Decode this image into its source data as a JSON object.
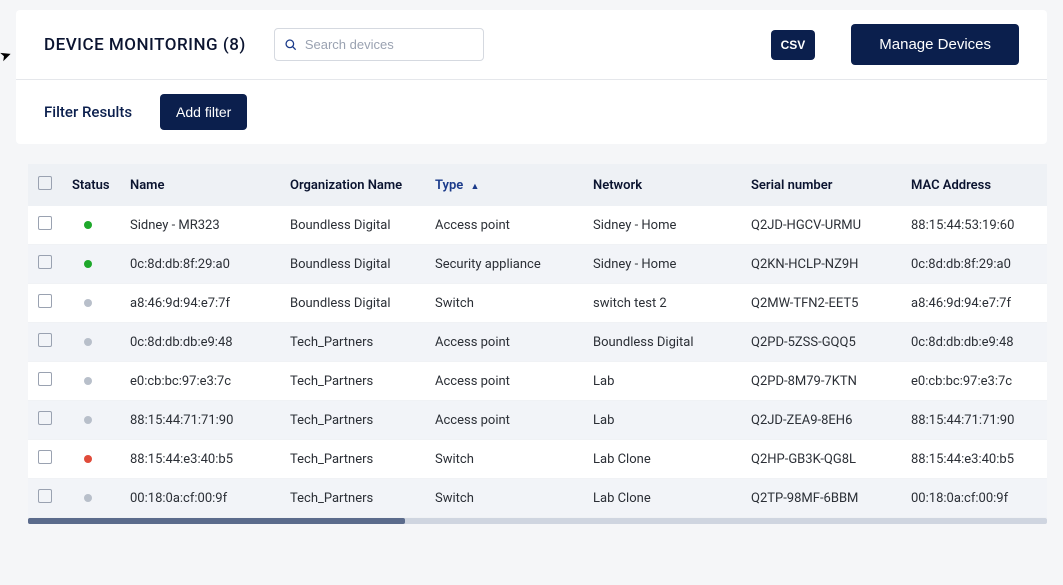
{
  "header": {
    "title": "DEVICE MONITORING (8)",
    "search_placeholder": "Search devices",
    "csv_label": "CSV",
    "manage_label": "Manage Devices"
  },
  "filter": {
    "results_label": "Filter Results",
    "add_filter_label": "Add filter"
  },
  "table": {
    "columns": {
      "status": "Status",
      "name": "Name",
      "org": "Organization Name",
      "type": "Type",
      "network": "Network",
      "serial": "Serial number",
      "mac": "MAC Address"
    },
    "sort_indicator": "▲",
    "rows": [
      {
        "status": "green",
        "name": "Sidney - MR323",
        "org": "Boundless Digital",
        "type": "Access point",
        "network": "Sidney - Home",
        "serial": "Q2JD-HGCV-URMU",
        "mac": "88:15:44:53:19:60",
        "shaded": false
      },
      {
        "status": "green",
        "name": "0c:8d:db:8f:29:a0",
        "org": "Boundless Digital",
        "type": "Security appliance",
        "network": "Sidney - Home",
        "serial": "Q2KN-HCLP-NZ9H",
        "mac": "0c:8d:db:8f:29:a0",
        "shaded": true
      },
      {
        "status": "gray",
        "name": "a8:46:9d:94:e7:7f",
        "org": "Boundless Digital",
        "type": "Switch",
        "network": "switch test 2",
        "serial": "Q2MW-TFN2-EET5",
        "mac": "a8:46:9d:94:e7:7f",
        "shaded": false
      },
      {
        "status": "gray",
        "name": "0c:8d:db:db:e9:48",
        "org": "Tech_Partners",
        "type": "Access point",
        "network": "Boundless Digital",
        "serial": "Q2PD-5ZSS-GQQ5",
        "mac": "0c:8d:db:db:e9:48",
        "shaded": true
      },
      {
        "status": "gray",
        "name": "e0:cb:bc:97:e3:7c",
        "org": "Tech_Partners",
        "type": "Access point",
        "network": "Lab",
        "serial": "Q2PD-8M79-7KTN",
        "mac": "e0:cb:bc:97:e3:7c",
        "shaded": false
      },
      {
        "status": "gray",
        "name": "88:15:44:71:71:90",
        "org": "Tech_Partners",
        "type": "Access point",
        "network": "Lab",
        "serial": "Q2JD-ZEA9-8EH6",
        "mac": "88:15:44:71:71:90",
        "shaded": true
      },
      {
        "status": "red",
        "name": "88:15:44:e3:40:b5",
        "org": "Tech_Partners",
        "type": "Switch",
        "network": "Lab Clone",
        "serial": "Q2HP-GB3K-QG8L",
        "mac": "88:15:44:e3:40:b5",
        "shaded": false
      },
      {
        "status": "gray",
        "name": "00:18:0a:cf:00:9f",
        "org": "Tech_Partners",
        "type": "Switch",
        "network": "Lab Clone",
        "serial": "Q2TP-98MF-6BBM",
        "mac": "00:18:0a:cf:00:9f",
        "shaded": true
      }
    ]
  }
}
